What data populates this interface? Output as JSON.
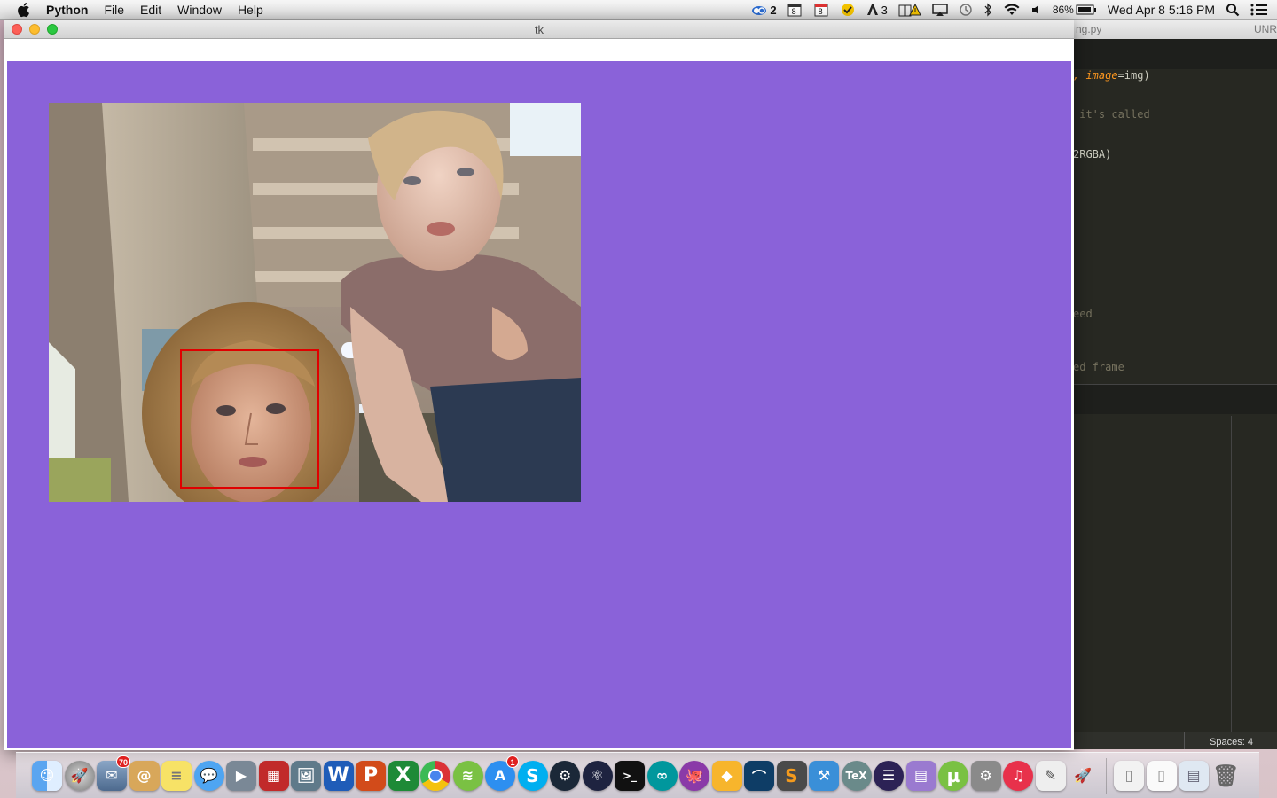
{
  "menubar": {
    "app_name": "Python",
    "menus": [
      "File",
      "Edit",
      "Window",
      "Help"
    ],
    "status": {
      "cc_count": "2",
      "cal1": "8",
      "cal2": "8",
      "adobe_count": "3",
      "battery": "86%",
      "clock": "Wed Apr 8  5:16 PM"
    }
  },
  "editor": {
    "filename": "ng.py",
    "unr": "UNR",
    "code": {
      "line1_orange": ", image",
      "line1_rest": "=img)",
      "line2": " it's called",
      "line3": "2RGBA)",
      "line4": "eed",
      "line5": "ed frame"
    },
    "status_spaces": "Spaces: 4"
  },
  "window": {
    "title": "tk",
    "canvas_color": "#8a62d9",
    "detection_box_color": "#e00000"
  },
  "dock": {
    "mail_badge": "70",
    "appstore_badge": "1"
  }
}
